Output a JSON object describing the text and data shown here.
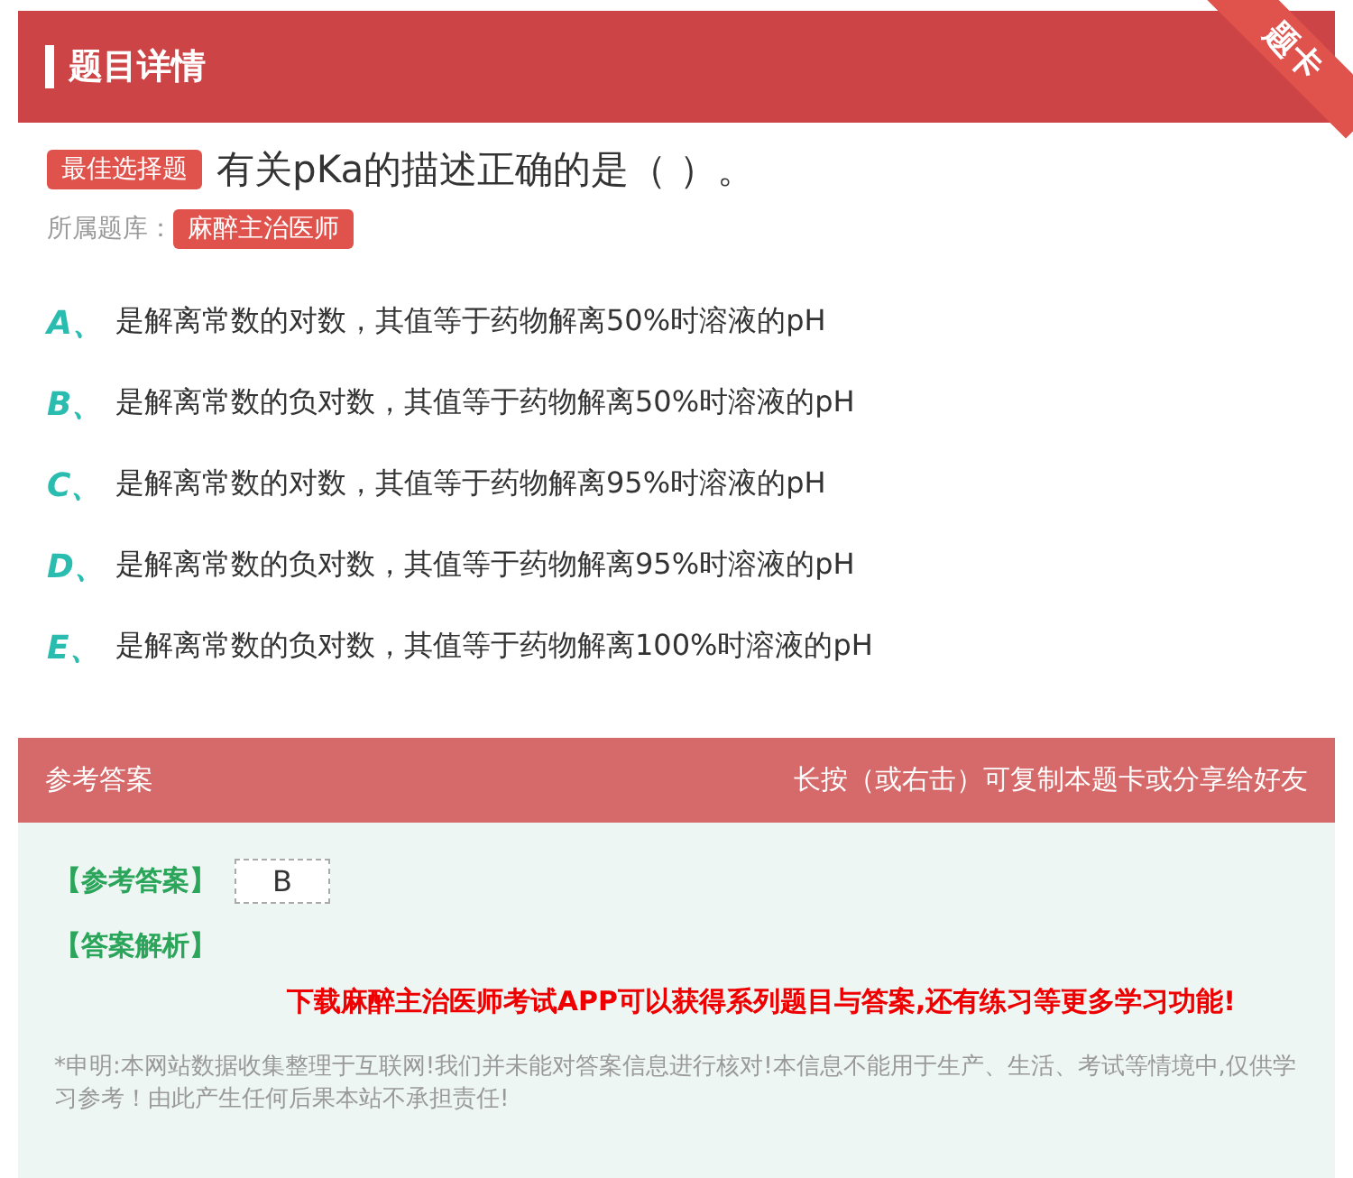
{
  "header": {
    "title": "题目详情",
    "ribbon": "题卡"
  },
  "question": {
    "type_badge": "最佳选择题",
    "text": "有关pKa的描述正确的是（ ）。",
    "bank_label": "所属题库：",
    "bank": "麻醉主治医师"
  },
  "options": [
    {
      "letter": "A、",
      "text": "是解离常数的对数，其值等于药物解离50%时溶液的pH"
    },
    {
      "letter": "B、",
      "text": "是解离常数的负对数，其值等于药物解离50%时溶液的pH"
    },
    {
      "letter": "C、",
      "text": "是解离常数的对数，其值等于药物解离95%时溶液的pH"
    },
    {
      "letter": "D、",
      "text": "是解离常数的负对数，其值等于药物解离95%时溶液的pH"
    },
    {
      "letter": "E、",
      "text": "是解离常数的负对数，其值等于药物解离100%时溶液的pH"
    }
  ],
  "answer_section": {
    "title": "参考答案",
    "hint": "长按（或右击）可复制本题卡或分享给好友",
    "answer_label": "【参考答案】",
    "answer": "B",
    "analysis_label": "【答案解析】",
    "promo": "下载麻醉主治医师考试APP可以获得系列题目与答案,还有练习等更多学习功能!",
    "disclaimer": "*申明:本网站数据收集整理于互联网!我们并未能对答案信息进行核对!本信息不能用于生产、生活、考试等情境中,仅供学习参考！由此产生任何后果本站不承担责任!"
  }
}
